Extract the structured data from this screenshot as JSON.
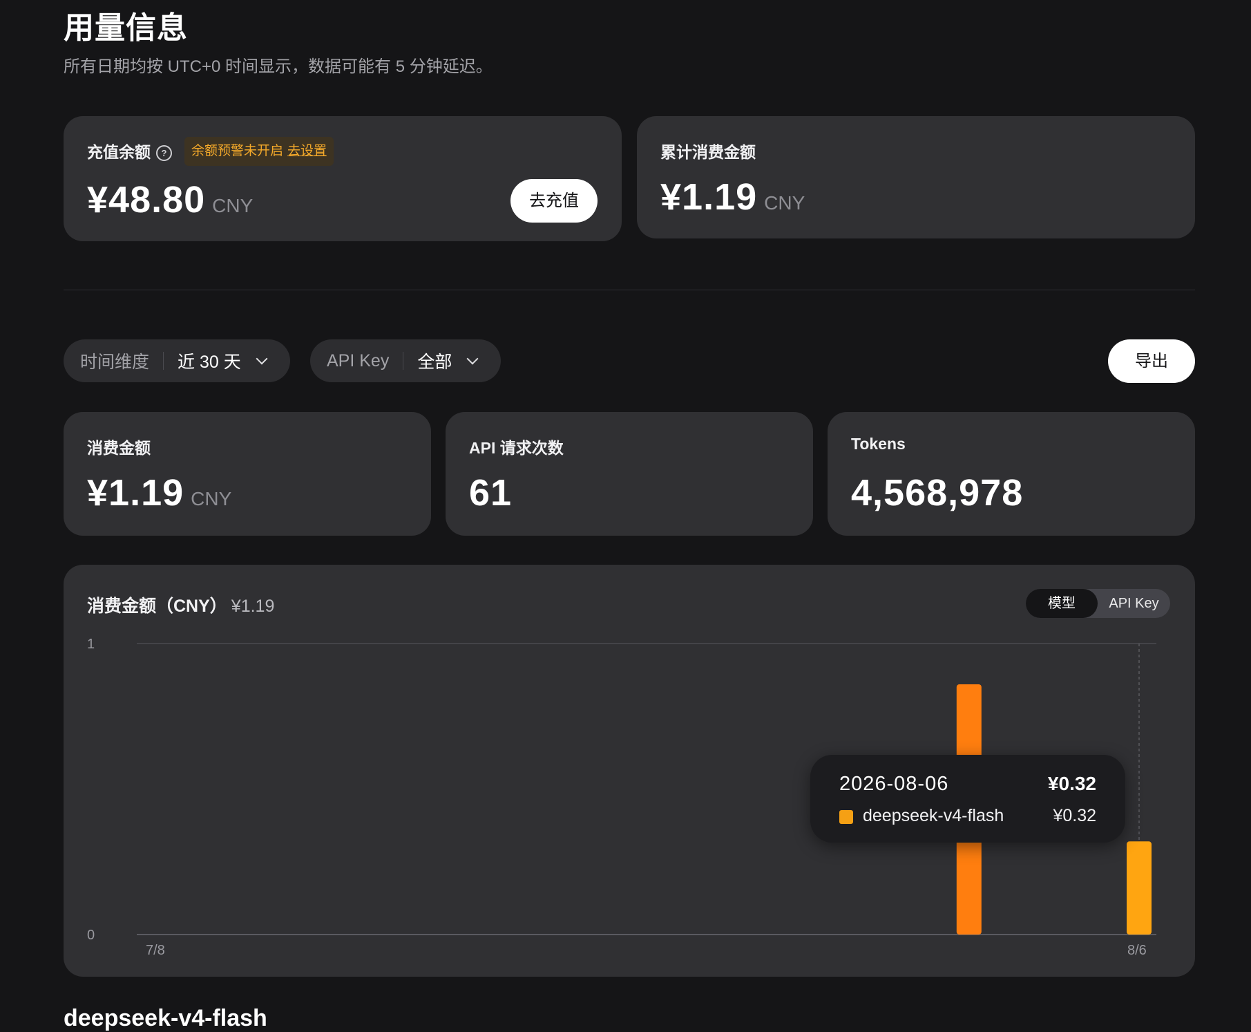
{
  "page": {
    "title": "用量信息",
    "subtitle": "所有日期均按 UTC+0 时间显示，数据可能有 5 分钟延迟。"
  },
  "balance_card": {
    "label": "充值余额",
    "help_icon": "question-circle-icon",
    "warning_text": "余额预警未开启",
    "warning_link": "去设置",
    "amount": "¥48.80",
    "unit": "CNY",
    "recharge_button": "去充值"
  },
  "total_spend_card": {
    "label": "累计消费金额",
    "amount": "¥1.19",
    "unit": "CNY"
  },
  "filters": {
    "time": {
      "label": "时间维度",
      "value": "近 30 天"
    },
    "api_key": {
      "label": "API Key",
      "value": "全部"
    },
    "export_button": "导出"
  },
  "stats": {
    "spend": {
      "label": "消费金额",
      "value": "¥1.19",
      "unit": "CNY"
    },
    "requests": {
      "label": "API 请求次数",
      "value": "61"
    },
    "tokens": {
      "label": "Tokens",
      "value": "4,568,978"
    }
  },
  "chart_panel": {
    "title": "消费金额（CNY）",
    "total": "¥1.19",
    "toggle": {
      "model": "模型",
      "api_key": "API Key",
      "active": "model"
    },
    "tooltip": {
      "date": "2026-08-06",
      "total": "¥0.32",
      "series_name": "deepseek-v4-flash",
      "series_value": "¥0.32",
      "swatch_color": "#f5a014"
    }
  },
  "chart_data": {
    "type": "bar",
    "x_labels": [
      "7/8",
      "8/6"
    ],
    "ylim": [
      0,
      1
    ],
    "y_ticks": [
      "0",
      "1"
    ],
    "series": [
      {
        "name": "deepseek-v4-flash",
        "values": [
          {
            "date": "2026-08-01",
            "value": 0.86,
            "color": "#ff7e0f"
          },
          {
            "date": "2026-08-06",
            "value": 0.32,
            "color": "#ffa511"
          }
        ]
      }
    ],
    "grid": true,
    "hover_date": "2026-08-06"
  },
  "colors": {
    "background": "#151517",
    "card": "#303033",
    "warning": "#f4a92a",
    "bar_orange": "#ff7e0f",
    "bar_amber": "#ffa511"
  }
}
